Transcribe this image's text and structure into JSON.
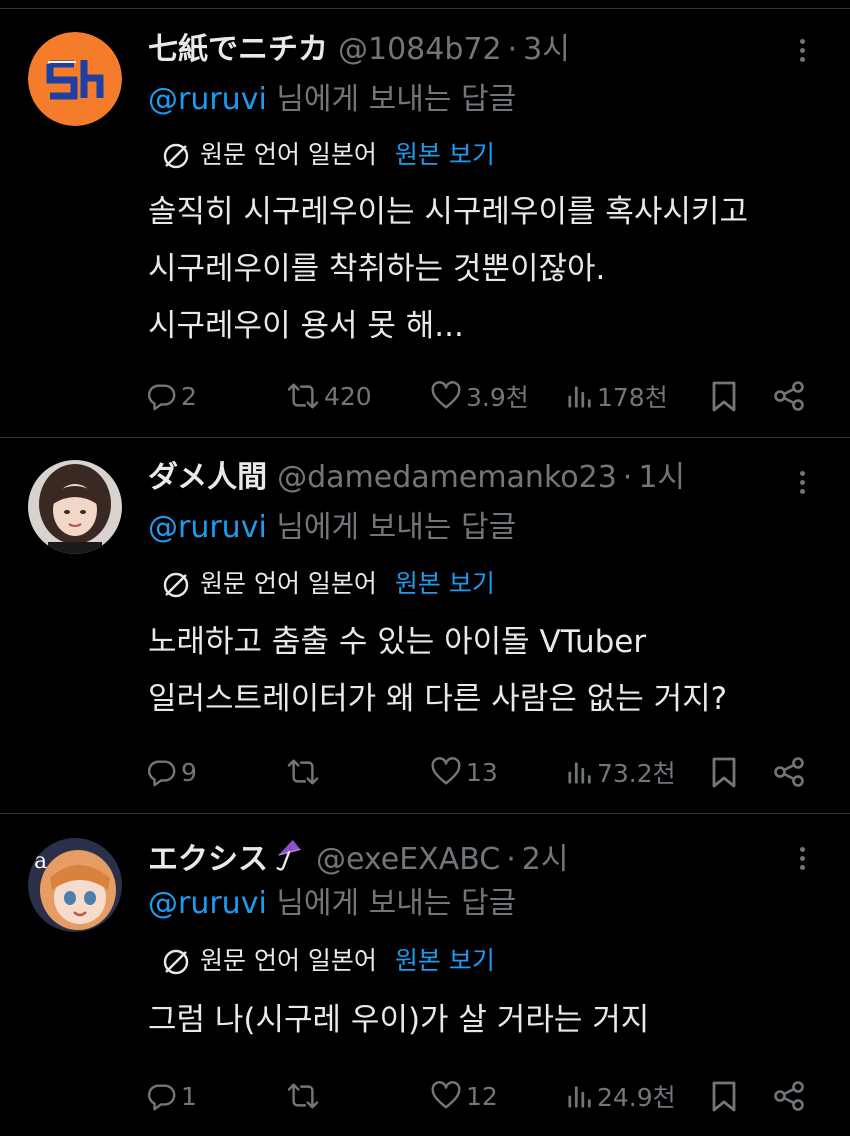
{
  "tweets": [
    {
      "display_name": "七紙でニチカ",
      "handle": "@1084b72",
      "time": "3시",
      "reply_mention": "@ruruvi",
      "reply_suffix": " 님에게 보내는 답글",
      "source_language": "원문 언어 일본어",
      "show_original": "원본 보기",
      "body": "솔직히 시구레우이는 시구레우이를 혹사시키고\n시구레우이를 착취하는 것뿐이잖아.\n시구레우이 용서 못 해...",
      "avatar_text": "Sh",
      "avatar_bg": "#f57c2b",
      "avatar_fg": "#1f3fa3",
      "replies": "2",
      "reposts": "420",
      "likes": "3.9천",
      "views": "178천"
    },
    {
      "display_name": "ダメ人間",
      "handle": "@damedamemanko23",
      "time": "1시",
      "reply_mention": "@ruruvi",
      "reply_suffix": " 님에게 보내는 답글",
      "source_language": "원문 언어 일본어",
      "show_original": "원본 보기",
      "body": "노래하고 춤출 수 있는 아이돌 VTuber\n일러스트레이터가 왜 다른 사람은 없는 거지?",
      "replies": "9",
      "reposts": "",
      "likes": "13",
      "views": "73.2천"
    },
    {
      "display_name": "エクシス",
      "handle": "@exeEXABC",
      "time": "2시",
      "reply_mention": "@ruruvi",
      "reply_suffix": " 님에게 보내는 답글",
      "source_language": "원문 언어 일본어",
      "show_original": "원본 보기",
      "body": "그럼 나(시구레 우이)가 살 거라는 거지",
      "avatar_text": "a",
      "replies": "1",
      "reposts": "",
      "likes": "12",
      "views": "24.9천"
    }
  ],
  "icons": {
    "reply": "reply-icon",
    "repost": "repost-icon",
    "like": "heart-icon",
    "views": "views-icon",
    "bookmark": "bookmark-icon",
    "share": "share-icon",
    "more": "more-icon",
    "translate": "translate-icon",
    "umbrella": "umbrella-icon"
  },
  "colors": {
    "background": "#000000",
    "text": "#e7e9ea",
    "muted": "#71767b",
    "link": "#1d9bf0",
    "divider": "#2f3336",
    "umbrella": "#8b4fc6"
  }
}
